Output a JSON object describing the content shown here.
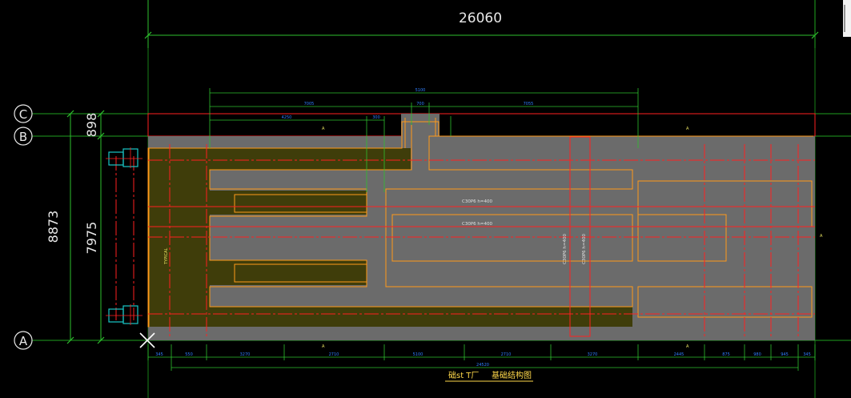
{
  "drawing": {
    "overall_width_dim": "26060",
    "overall_height_dim": "8873",
    "inner_height_dim": "7975",
    "top_offset_dim": "898",
    "axes": [
      "C",
      "B",
      "A"
    ],
    "drawing_title": "础st T厂",
    "colors": {
      "background": "#000000",
      "slab": "#6b6b6b",
      "thick_zone": "#3f3d0a",
      "grid_line": "#1fa11f",
      "dim_line": "#2ec02e",
      "boundary": "#ff2020",
      "opening": "#ff9a1a",
      "text": "#e8e8e8"
    },
    "icons": [
      "cursor-cross-icon",
      "column-cap-icon"
    ]
  }
}
